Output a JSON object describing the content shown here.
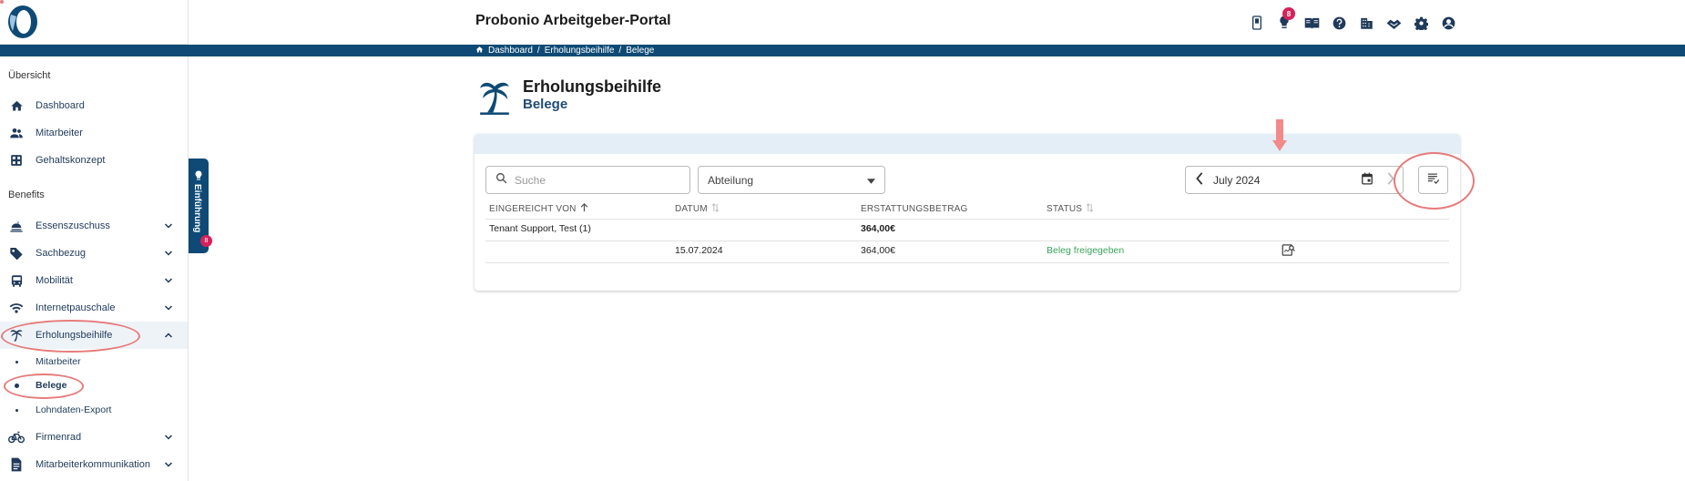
{
  "app": {
    "title": "Probonio Arbeitgeber-Portal",
    "notification_count": "8"
  },
  "breadcrumb": {
    "items": [
      "Dashboard",
      "Erholungsbeihilfe",
      "Belege"
    ],
    "separator": "/"
  },
  "sidebar": {
    "section_overview": "Übersicht",
    "section_benefits": "Benefits",
    "items": [
      {
        "label": "Dashboard",
        "icon": "home-icon"
      },
      {
        "label": "Mitarbeiter",
        "icon": "people-icon"
      },
      {
        "label": "Gehaltskonzept",
        "icon": "grid-icon"
      },
      {
        "label": "Essenszuschuss",
        "icon": "food-icon"
      },
      {
        "label": "Sachbezug",
        "icon": "tag-icon"
      },
      {
        "label": "Mobilität",
        "icon": "bus-icon"
      },
      {
        "label": "Internetpauschale",
        "icon": "wifi-icon"
      },
      {
        "label": "Erholungsbeihilfe",
        "icon": "palm-icon"
      },
      {
        "label": "Firmenrad",
        "icon": "bike-icon"
      },
      {
        "label": "Mitarbeiterkommunikation",
        "icon": "document-icon"
      }
    ],
    "subitems": [
      {
        "label": "Mitarbeiter"
      },
      {
        "label": "Belege"
      },
      {
        "label": "Lohndaten-Export"
      }
    ]
  },
  "intro_tab": {
    "label": "Einführung",
    "badge": "8"
  },
  "page": {
    "title": "Erholungsbeihilfe",
    "subtitle": "Belege"
  },
  "filters": {
    "search_placeholder": "Suche",
    "department_label": "Abteilung",
    "month_value": "July 2024"
  },
  "table": {
    "headers": [
      "EINGEREICHT VON",
      "DATUM",
      "ERSTATTUNGSBETRAG",
      "STATUS"
    ],
    "group": {
      "name": "Tenant Support, Test (1)",
      "amount": "364,00€"
    },
    "rows": [
      {
        "date": "15.07.2024",
        "amount": "364,00€",
        "status": "Beleg freigegeben"
      }
    ]
  },
  "colors": {
    "primary": "#0e4a75",
    "accent": "#d6215c",
    "success": "#3aa55c",
    "annotation": "#e77b7b"
  }
}
